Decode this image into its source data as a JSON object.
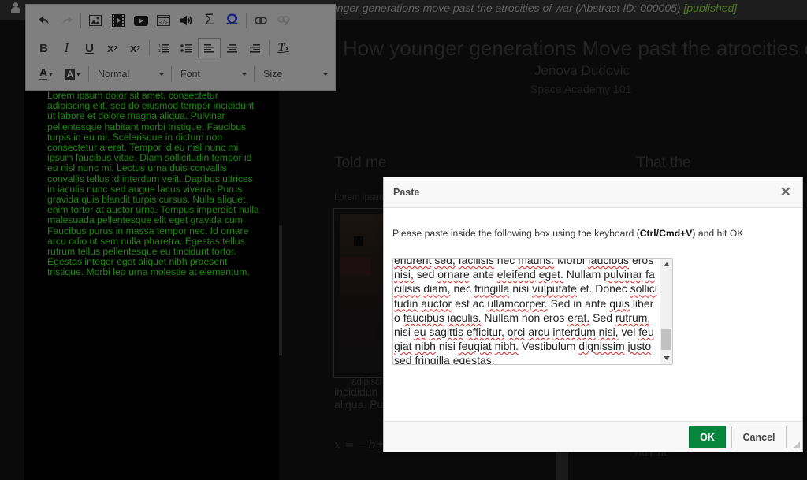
{
  "topbar": {
    "user_icon": "user-icon",
    "title_visible": "unger generations move past the atrocities of war (Abstract ID: 000005)",
    "status": "[published]",
    "status_color": "#4e7a1e"
  },
  "toolbar": {
    "row1": [
      {
        "icon": "undo-icon",
        "glyph": "↶",
        "state": "enabled"
      },
      {
        "icon": "redo-icon",
        "glyph": "↷",
        "state": "disabled"
      },
      {
        "icon": "image-icon",
        "glyph": "🖼",
        "state": "enabled"
      },
      {
        "icon": "video-icon",
        "glyph": "🎞",
        "state": "enabled"
      },
      {
        "icon": "youtube-icon",
        "glyph": "▶",
        "state": "enabled"
      },
      {
        "icon": "iframe-icon",
        "glyph": "</>",
        "state": "enabled"
      },
      {
        "icon": "audio-icon",
        "glyph": "🔊",
        "state": "enabled"
      },
      {
        "icon": "sum-icon",
        "glyph": "Σ",
        "state": "enabled"
      },
      {
        "icon": "special-char-icon",
        "glyph": "Ω",
        "state": "enabled"
      },
      {
        "icon": "link-icon",
        "glyph": "🔗",
        "state": "enabled"
      },
      {
        "icon": "unlink-icon",
        "glyph": "⛓",
        "state": "disabled"
      }
    ],
    "row2": [
      {
        "icon": "bold-icon",
        "glyph": "B"
      },
      {
        "icon": "italic-icon",
        "glyph": "I"
      },
      {
        "icon": "underline-icon",
        "glyph": "U"
      },
      {
        "icon": "subscript-icon",
        "glyph": "x₂"
      },
      {
        "icon": "superscript-icon",
        "glyph": "x²"
      },
      {
        "icon": "numbered-list-icon",
        "glyph": "⅟≡"
      },
      {
        "icon": "bulleted-list-icon",
        "glyph": "•≡"
      },
      {
        "icon": "align-left-icon",
        "glyph": "≡",
        "active": true
      },
      {
        "icon": "align-center-icon",
        "glyph": "≡"
      },
      {
        "icon": "align-right-icon",
        "glyph": "≡"
      },
      {
        "icon": "remove-format-icon",
        "glyph": "Tₓ"
      }
    ],
    "row3": {
      "text_color": {
        "icon": "text-color-icon",
        "glyph": "A"
      },
      "bg_color": {
        "icon": "background-color-icon",
        "glyph": "A"
      },
      "format": "Normal",
      "font": "Font",
      "size": "Size"
    }
  },
  "editor": {
    "text": "Lorem ipsum dolor sit amet, consectetur adipiscing elit, sed do eiusmod tempor incididunt ut labore et dolore magna aliqua. Pulvinar pellentesque habitant morbi tristique. Faucibus turpis in eu mi. Scelerisque in dictum non consectetur a erat. Tempor id eu nisl nunc mi ipsum faucibus vitae. Diam sollicitudin tempor id eu nisl nunc mi. Lectus urna duis convallis convallis tellus id interdum velit. Dapibus ultrices in iaculis nunc sed augue lacus viverra. Purus gravida quis blandit turpis cursus. Nulla aliquet enim tortor at auctor urna. Tempus imperdiet nulla malesuada pellentesque elit eget gravida cum. Faucibus purus in massa tempor nec. Id ornare arcu odio ut sem nulla pharetra. Egestas tellus rutrum tellus pellentesque eu tincidunt tortor. Egestas integer eget aliquet nibh praesent tristique. Morbi leo urna molestie at elementum.",
    "text_color": "#1f8a0e"
  },
  "background": {
    "title": "How younger generations Move past the atrocities of w",
    "author": "Jenova Dudovic",
    "organization": "Space Academy 101",
    "column_a_heading": "Told me",
    "column_b_heading": "That the",
    "column_a_lorem": "Lorem ipsum",
    "figure_caption": "adipisci",
    "paragraph_line1": "incididun",
    "paragraph_line2": "aliqua. Pu",
    "formula": "x = −b±",
    "column_b_footer": "Hull the"
  },
  "dialog": {
    "title": "Paste",
    "close_icon": "close-icon",
    "instruction_prefix": "Please paste inside the following box using the keyboard (",
    "instruction_shortcut": "Ctrl/Cmd+V",
    "instruction_suffix": ") and hit OK",
    "paste_content": "endrerit sed, facilisis nec mauris. Morbi faucibus eros nisi, sed ornare ante eleifend eget. Nullam pulvinar facilisis diam, nec fringilla nisi vulputate et. Donec sollicitudin auctor est ac ullamcorper. Sed in ante quis libero faucibus iaculis. Nullam non eros erat. Sed rutrum, nisi eu sagittis efficitur, orci arcu interdum nisi, vel feugiat nibh nisi feugiat nibh. Vestibulum dignissim justo sed fringilla egestas.",
    "ok_label": "OK",
    "cancel_label": "Cancel",
    "ok_color": "#09863e"
  }
}
